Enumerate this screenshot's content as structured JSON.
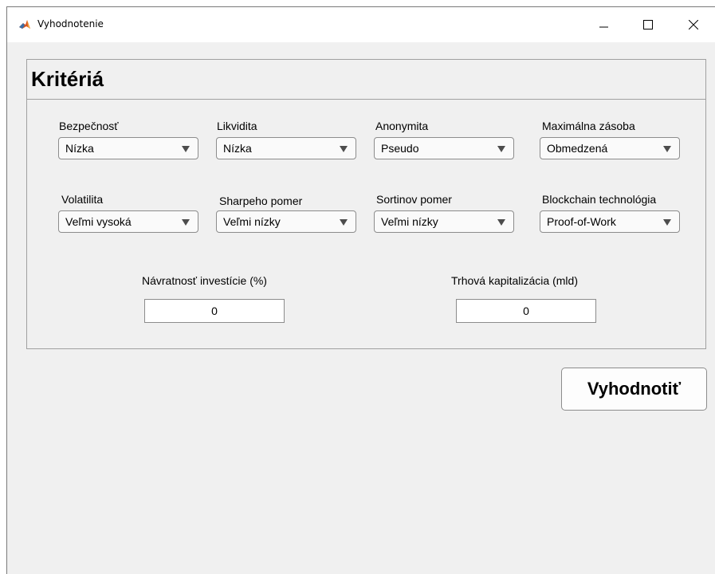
{
  "window": {
    "title": "Vyhodnotenie"
  },
  "panel": {
    "title": "Kritériá"
  },
  "criteria": {
    "bezpecnost": {
      "label": "Bezpečnosť",
      "value": "Nízka"
    },
    "likvidita": {
      "label": "Likvidita",
      "value": "Nízka"
    },
    "anonymita": {
      "label": "Anonymita",
      "value": "Pseudo"
    },
    "zasoba": {
      "label": "Maximálna zásoba",
      "value": "Obmedzená"
    },
    "volatilita": {
      "label": "Volatilita",
      "value": "Veľmi vysoká"
    },
    "sharpe": {
      "label": "Sharpeho pomer",
      "value": "Veľmi nízky"
    },
    "sortino": {
      "label": "Sortinov pomer",
      "value": "Veľmi nízky"
    },
    "blockchain": {
      "label": "Blockchain technológia",
      "value": "Proof-of-Work"
    }
  },
  "numeric": {
    "navratnost": {
      "label": "Návratnosť investície (%)",
      "value": "0"
    },
    "kapitalizacia": {
      "label": "Trhová kapitalizácia (mld)",
      "value": "0"
    }
  },
  "actions": {
    "evaluate_label": "Vyhodnotiť"
  },
  "icons": {
    "app": "matlab-icon",
    "minimize": "minimize-icon",
    "maximize": "maximize-icon",
    "close": "close-icon",
    "dropdown": "dropdown-arrow-icon"
  },
  "colors": {
    "window_bg": "#f0f0f0",
    "titlebar_bg": "#ffffff",
    "border": "#a0a0a0"
  }
}
